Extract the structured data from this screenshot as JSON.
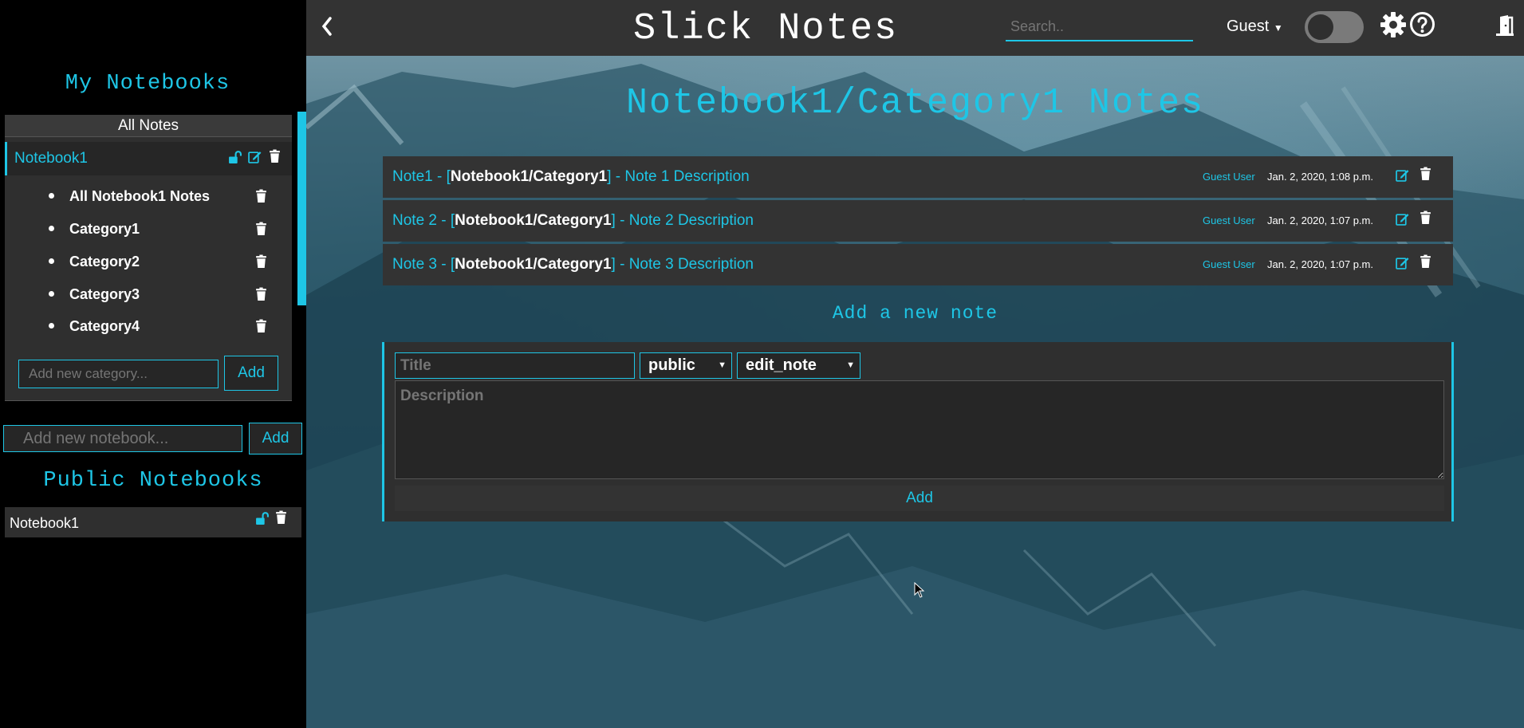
{
  "app": {
    "title": "Slick Notes",
    "back_icon": "chevron-left-icon"
  },
  "header": {
    "search_placeholder": "Search..",
    "user_menu_label": "Guest",
    "theme_toggle_on": false,
    "icons": [
      "gear-icon",
      "help-icon",
      "logout-door-icon"
    ]
  },
  "sidebar": {
    "my_notebooks_title": "My Notebooks",
    "all_notes_label": "All Notes",
    "notebook": {
      "label": "Notebook1",
      "icons": [
        "unlock-icon",
        "edit-icon",
        "trash-icon"
      ]
    },
    "categories": [
      {
        "label": "All Notebook1 Notes"
      },
      {
        "label": "Category1"
      },
      {
        "label": "Category2"
      },
      {
        "label": "Category3"
      },
      {
        "label": "Category4"
      }
    ],
    "add_category_placeholder": "Add new category...",
    "add_category_button": "Add",
    "add_notebook_placeholder": "Add new notebook...",
    "add_notebook_button": "Add",
    "public_notebooks_title": "Public Notebooks",
    "public_notebooks": [
      {
        "label": "Notebook1"
      }
    ]
  },
  "main": {
    "page_title": "Notebook1/Category1 Notes",
    "notes": [
      {
        "title": "Note1",
        "path": "Notebook1/Category1",
        "description": "Note 1 Description",
        "author": "Guest User",
        "date": "Jan. 2, 2020, 1:08 p.m."
      },
      {
        "title": "Note 2",
        "path": "Notebook1/Category1",
        "description": "Note 2 Description",
        "author": "Guest User",
        "date": "Jan. 2, 2020, 1:07 p.m."
      },
      {
        "title": "Note 3",
        "path": "Notebook1/Category1",
        "description": "Note 3 Description",
        "author": "Guest User",
        "date": "Jan. 2, 2020, 1:07 p.m."
      }
    ],
    "add_note_title": "Add a new note",
    "form": {
      "title_placeholder": "Title",
      "visibility_value": "public",
      "type_value": "edit_note",
      "description_placeholder": "Description",
      "submit_label": "Add"
    }
  },
  "colors": {
    "accent": "#1ec6e6",
    "panel": "#333333",
    "sidebar_bg": "#000000"
  }
}
